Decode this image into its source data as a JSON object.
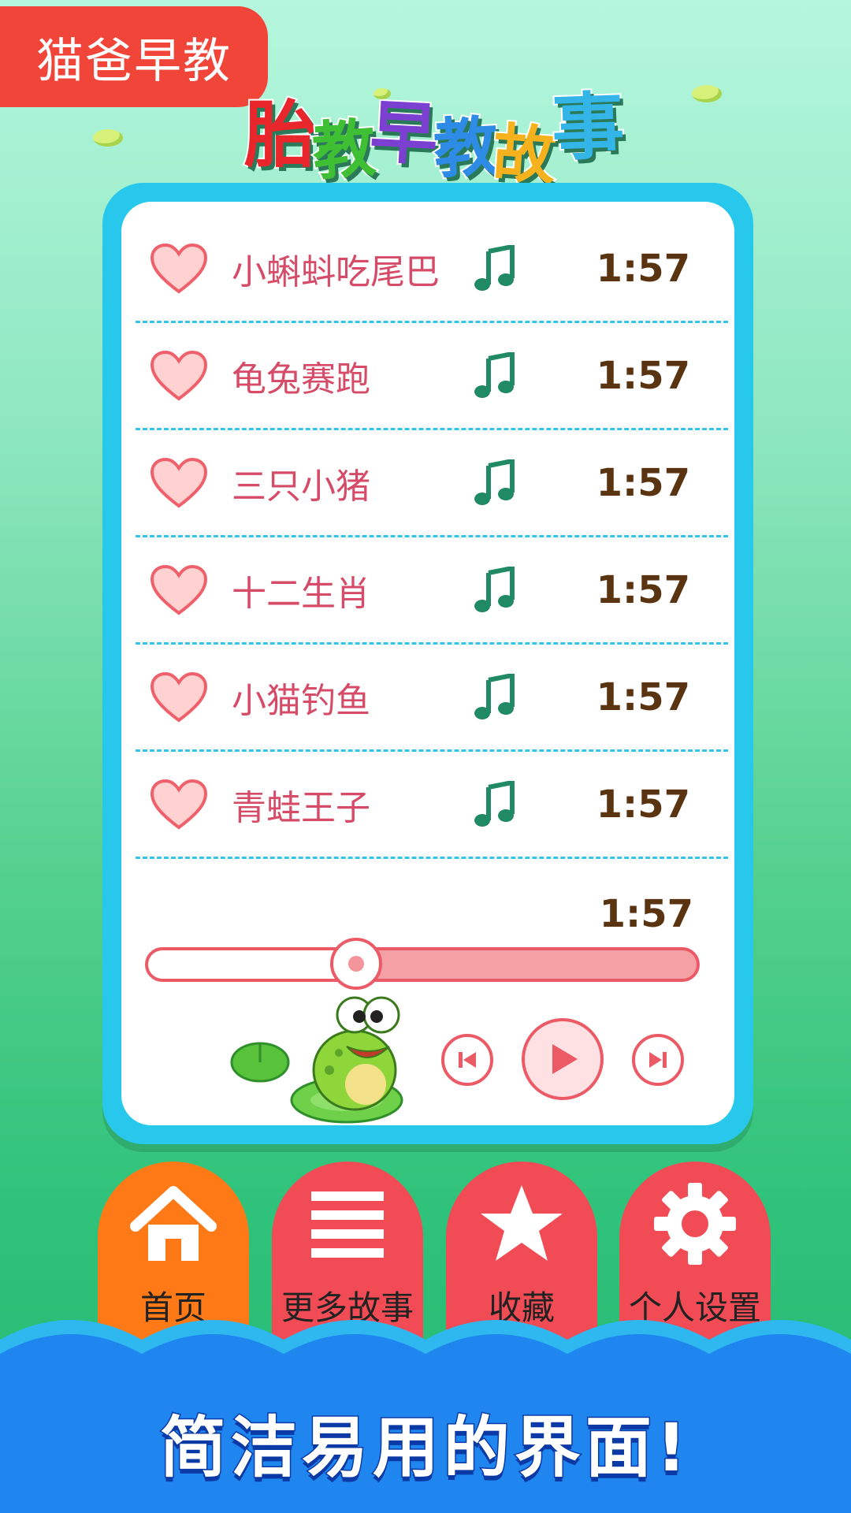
{
  "brand": {
    "label": "猫爸早教"
  },
  "app_title": {
    "chars": [
      "胎",
      "教",
      "早",
      "教",
      "故",
      "事"
    ],
    "colors": [
      "#e8262c",
      "#3fbf33",
      "#7b3fd1",
      "#2e8be6",
      "#f5b21c",
      "#33b5e8"
    ]
  },
  "playlist": {
    "items": [
      {
        "title": "小蝌蚪吃尾巴",
        "duration": "1:57"
      },
      {
        "title": "龟兔赛跑",
        "duration": "1:57"
      },
      {
        "title": "三只小猪",
        "duration": "1:57"
      },
      {
        "title": "十二生肖",
        "duration": "1:57"
      },
      {
        "title": "小猫钓鱼",
        "duration": "1:57"
      },
      {
        "title": "青蛙王子",
        "duration": "1:57"
      }
    ],
    "icons": {
      "favorite": "heart-icon",
      "audio": "music-note-icon"
    }
  },
  "player": {
    "total_time": "1:57",
    "progress": 0.38,
    "controls": {
      "prev": "skip-previous-icon",
      "play": "play-icon",
      "next": "skip-next-icon"
    }
  },
  "nav": {
    "tabs": [
      {
        "label": "首页",
        "icon": "home-icon",
        "active": true
      },
      {
        "label": "更多故事",
        "icon": "list-icon",
        "active": false
      },
      {
        "label": "收藏",
        "icon": "star-icon",
        "active": false
      },
      {
        "label": "个人设置",
        "icon": "gear-icon",
        "active": false
      }
    ]
  },
  "banner": {
    "text": "简洁易用的界面!"
  },
  "colors": {
    "accent_red": "#f14c55",
    "accent_orange": "#ff7a16",
    "card_border": "#28c8ec",
    "wave_blue": "#1e86ee"
  }
}
